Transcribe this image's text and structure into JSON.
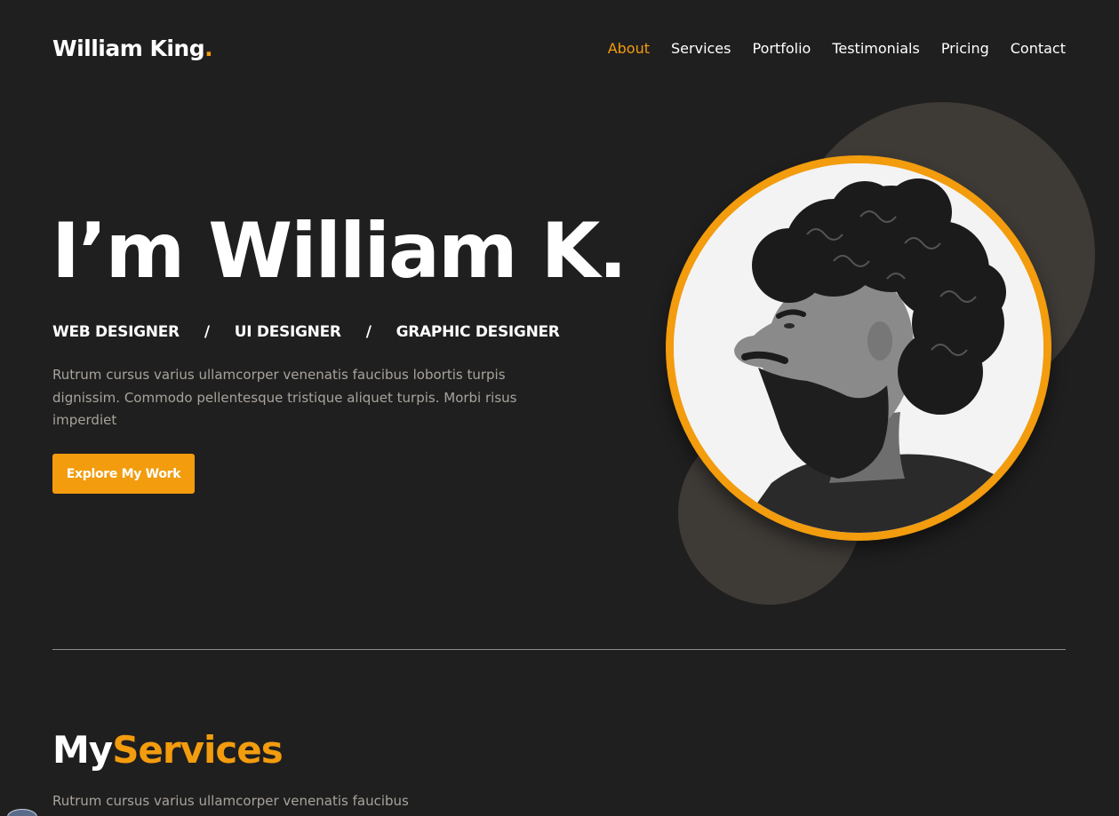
{
  "header": {
    "logo_name": "William King",
    "logo_dot": ".",
    "nav": [
      {
        "label": "About",
        "active": true
      },
      {
        "label": "Services",
        "active": false
      },
      {
        "label": "Portfolio",
        "active": false
      },
      {
        "label": "Testimonials",
        "active": false
      },
      {
        "label": "Pricing",
        "active": false
      },
      {
        "label": "Contact",
        "active": false
      }
    ]
  },
  "hero": {
    "title": "I’m William K.",
    "roles": [
      "WEB DESIGNER",
      "UI DESIGNER",
      "GRAPHIC DESIGNER"
    ],
    "separator": "/",
    "description": "Rutrum cursus varius ullamcorper venenatis faucibus lobortis turpis dignissim. Commodo pellentesque tristique aliquet turpis. Morbi risus imperdiet",
    "cta_label": "Explore My Work",
    "portrait_icon": "portrait-photo"
  },
  "services": {
    "title_plain": "My",
    "title_accent": "Services",
    "description": "Rutrum cursus varius ullamcorper venenatis faucibus"
  },
  "colors": {
    "accent": "#f29c0e",
    "background": "#201f1f",
    "muted_text": "#a7a39d",
    "blob": "#3e3b37"
  }
}
